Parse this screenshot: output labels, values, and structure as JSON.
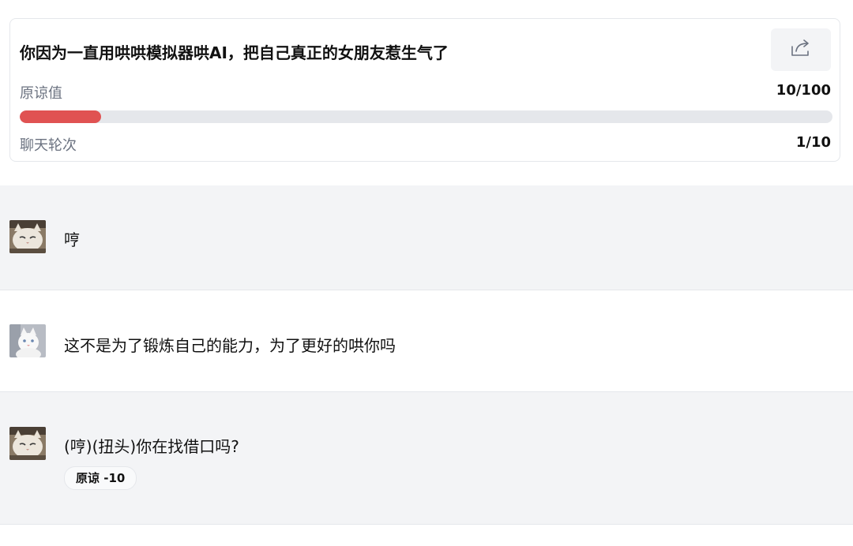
{
  "header": {
    "title": "你因为一直用哄哄模拟器哄AI，把自己真正的女朋友惹生气了",
    "share_icon": "share-icon",
    "forgiveness_label": "原谅值",
    "forgiveness_value": "10/100",
    "forgiveness_progress": 0.1,
    "forgiveness_color": "#e05252",
    "rounds_label": "聊天轮次",
    "rounds_value": "1/10"
  },
  "messages": [
    {
      "role": "girlfriend",
      "avatar_icon": "cat-avatar-icon",
      "text": "哼"
    },
    {
      "role": "user",
      "avatar_icon": "white-cat-avatar-icon",
      "text": "这不是为了锻炼自己的能力，为了更好的哄你吗"
    },
    {
      "role": "girlfriend",
      "avatar_icon": "cat-avatar-icon",
      "text": "(哼)(扭头)你在找借口吗?",
      "badge": "原谅 -10"
    }
  ]
}
